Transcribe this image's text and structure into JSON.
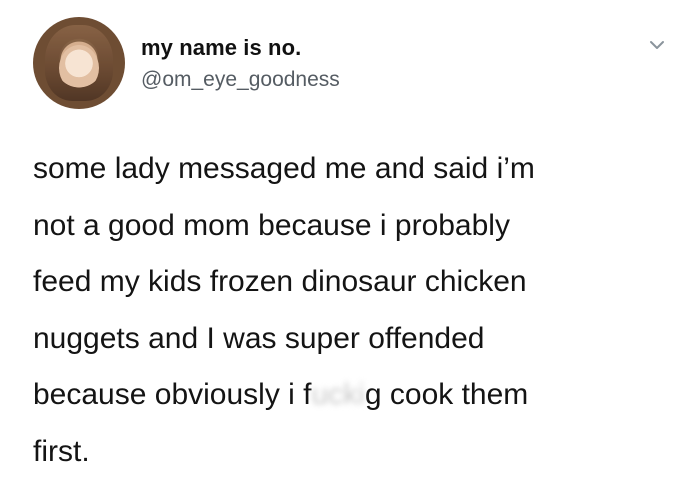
{
  "tweet": {
    "display_name": "my name is no.",
    "handle": "@om_eye_goodness",
    "menu_icon": "chevron-down-icon",
    "text_lines": [
      "some lady messaged me and said i’m",
      "not a good mom because i probably",
      "feed my kids frozen dinosaur chicken",
      "nuggets and I was super offended"
    ],
    "line5_before": "because obviously i f",
    "line5_censored": "ucki",
    "line5_after": "g cook them",
    "line6": "first."
  }
}
